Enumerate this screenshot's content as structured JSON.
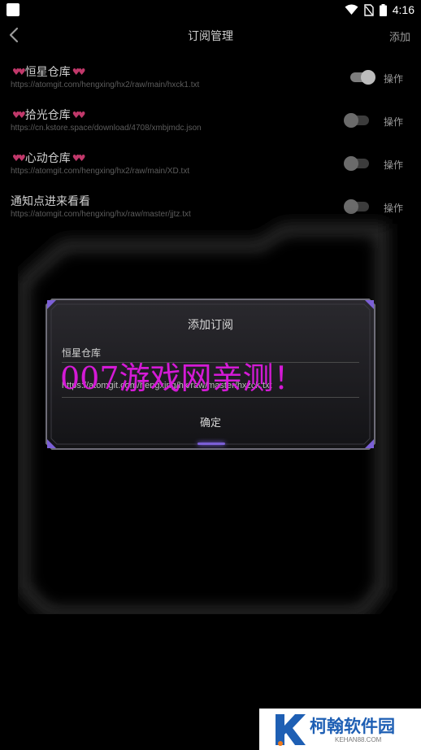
{
  "status_bar": {
    "time": "4:16",
    "icons": [
      "app-icon",
      "wifi-icon",
      "no-sim-icon",
      "battery-icon"
    ]
  },
  "header": {
    "title": "订阅管理",
    "add_label": "添加",
    "back_icon": "chevron-left-icon"
  },
  "subscriptions": [
    {
      "name": "恒星仓库",
      "hearts": true,
      "url": "https://atomgit.com/hengxing/hx2/raw/main/hxck1.txt",
      "enabled": true,
      "action_label": "操作"
    },
    {
      "name": "拾光仓库",
      "hearts": true,
      "url": "https://cn.kstore.space/download/4708/xmbjmdc.json",
      "enabled": false,
      "action_label": "操作"
    },
    {
      "name": "心动仓库",
      "hearts": true,
      "url": "https://atomgit.com/hengxing/hx2/raw/main/XD.txt",
      "enabled": false,
      "action_label": "操作"
    },
    {
      "name": "通知点进来看看",
      "hearts": false,
      "url": "https://atomgit.com/hengxing/hx/raw/master/jjtz.txt",
      "enabled": false,
      "action_label": "操作"
    }
  ],
  "dialog": {
    "title": "添加订阅",
    "name_value": "恒星仓库",
    "url_value": "https://atomgit.com/hengxing/hx/raw/master/hxzck.txt",
    "confirm_label": "确定"
  },
  "watermark": "007游戏网亲测！",
  "logo": {
    "text": "柯翰软件园",
    "subtext": "KEHAN88.COM"
  },
  "colors": {
    "background": "#000000",
    "heart": "#c0386a",
    "accent_purple": "#7b5fd6",
    "watermark": "#d41ad6",
    "logo_blue": "#1e5fb4"
  }
}
